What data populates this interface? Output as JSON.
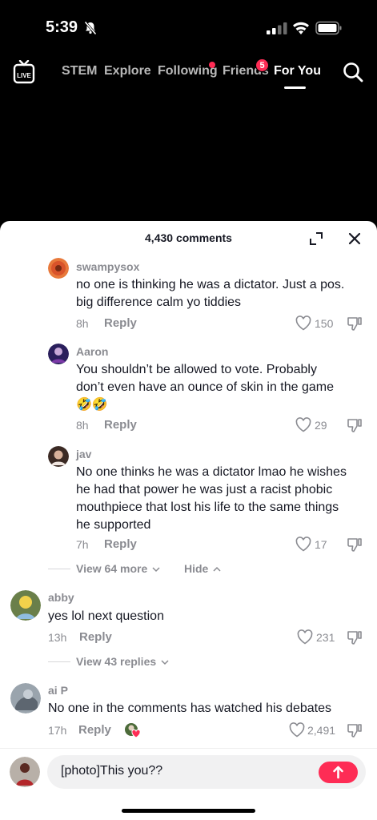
{
  "status": {
    "time": "5:39"
  },
  "nav": {
    "live_label": "LIVE",
    "tabs": [
      {
        "label": "STEM"
      },
      {
        "label": "Explore"
      },
      {
        "label": "Following"
      },
      {
        "label": "Friends"
      },
      {
        "label": "For You"
      }
    ],
    "friends_badge": "5",
    "active_tab": "For You"
  },
  "sheet": {
    "title": "4,430 comments",
    "comments": [
      {
        "user": "swampysox",
        "text": [
          "no one is thinking he was a dictator. Just a pos.",
          "big difference calm yo tiddies"
        ],
        "time": "8h",
        "reply": "Reply",
        "likes": "150"
      },
      {
        "user": "Aaron",
        "text": [
          "You shouldn’t be allowed to vote. Probably",
          "don’t even have an ounce of skin in the game",
          "🤣🤣"
        ],
        "time": "8h",
        "reply": "Reply",
        "likes": "29"
      },
      {
        "user": "jav",
        "text": [
          "No one thinks he was a dictator lmao he wishes",
          "he had that power he was just a racist phobic",
          "mouthpiece that lost his life to the same things",
          "he supported"
        ],
        "time": "7h",
        "reply": "Reply",
        "likes": "17"
      },
      {
        "user": "abby",
        "text": [
          "yes lol next question"
        ],
        "time": "13h",
        "reply": "Reply",
        "likes": "231"
      },
      {
        "user": "ai P",
        "text": [
          "No one in the comments has watched his debates"
        ],
        "time": "17h",
        "reply": "Reply",
        "likes": "2,491"
      }
    ],
    "view_more_1": "View 64 more",
    "hide": "Hide",
    "view_more_2": "View 43 replies"
  },
  "input": {
    "value": "[photo]This you??"
  },
  "colors": {
    "accent": "#fe2c55",
    "secondary_text": "#8a8b91"
  }
}
